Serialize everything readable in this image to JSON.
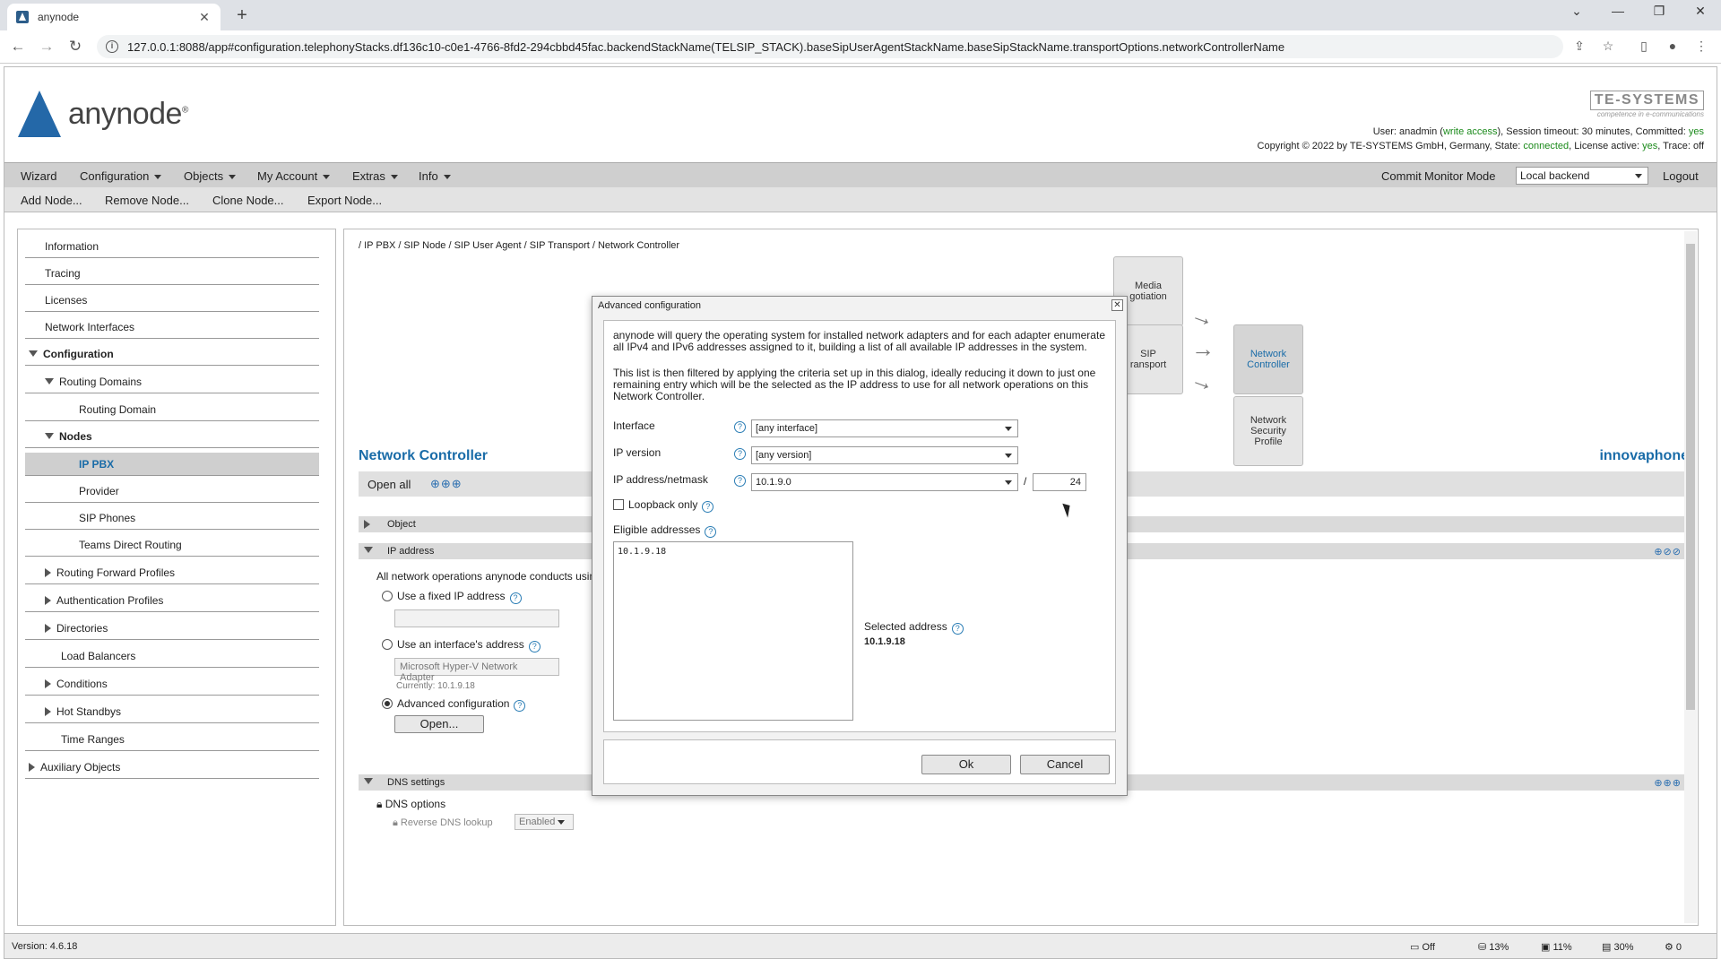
{
  "browser": {
    "tab_title": "anynode",
    "url": "127.0.0.1:8088/app#configuration.telephonyStacks.df136c10-c0e1-4766-8fd2-294cbbd45fac.backendStackName(TELSIP_STACK).baseSipUserAgentStackName.baseSipStackName.transportOptions.networkControllerName"
  },
  "header": {
    "logo_text": "anynode",
    "te_logo": "TE-SYSTEMS",
    "te_tagline": "competence in e-communications",
    "user_prefix": "User: anadmin (",
    "user_access": "write access",
    "user_suffix": "), Session timeout: 30 minutes, Committed: ",
    "committed": "yes",
    "copyright_prefix": "Copyright © 2022 by TE-SYSTEMS GmbH, Germany, State: ",
    "state": "connected",
    "license_prefix": ", License active: ",
    "license": "yes",
    "trace_prefix": ", Trace: ",
    "trace": "off"
  },
  "menu": {
    "wizard": "Wizard",
    "configuration": "Configuration",
    "objects": "Objects",
    "my_account": "My Account",
    "extras": "Extras",
    "info": "Info",
    "commit": "Commit",
    "monitor_mode": "Monitor Mode",
    "backend": "Local backend",
    "logout": "Logout"
  },
  "toolbar": {
    "add_node": "Add Node...",
    "remove_node": "Remove Node...",
    "clone_node": "Clone Node...",
    "export_node": "Export Node..."
  },
  "nav": {
    "information": "Information",
    "tracing": "Tracing",
    "licenses": "Licenses",
    "network_interfaces": "Network Interfaces",
    "configuration": "Configuration",
    "routing_domains": "Routing Domains",
    "routing_domain": "Routing Domain",
    "nodes": "Nodes",
    "ip_pbx": "IP PBX",
    "provider": "Provider",
    "sip_phones": "SIP Phones",
    "teams_direct_routing": "Teams Direct Routing",
    "routing_forward_profiles": "Routing Forward Profiles",
    "authentication_profiles": "Authentication Profiles",
    "directories": "Directories",
    "load_balancers": "Load Balancers",
    "conditions": "Conditions",
    "hot_standbys": "Hot Standbys",
    "time_ranges": "Time Ranges",
    "auxiliary_objects": "Auxiliary Objects"
  },
  "content": {
    "breadcrumb": "/ IP PBX / SIP Node / SIP User Agent / SIP Transport / Network Controller",
    "diagram": {
      "media": "Media\ngotiation",
      "transport": "SIP\nransport",
      "network_controller": "Network\nController",
      "security_profile": "Network\nSecurity\nProfile"
    },
    "title": "Network Controller",
    "brand": "innovaphone",
    "open_all": "Open all",
    "object_section": "Object",
    "ip_section": "IP address",
    "ip_description": "All network operations anynode conducts usin",
    "fixed_ip": "Use a fixed IP address",
    "interface_address": "Use an interface's address",
    "interface_value": "Microsoft Hyper-V Network Adapter",
    "currently": "Currently: 10.1.9.18",
    "advanced": "Advanced configuration",
    "open_button": "Open...",
    "dns_section": "DNS settings",
    "dns_options": "DNS options",
    "reverse_dns": "Reverse DNS lookup",
    "reverse_dns_value": "Enabled"
  },
  "status": {
    "version": "Version: 4.6.18",
    "monitor": "Off",
    "disk": "13%",
    "cpu": "11%",
    "memory": "30%",
    "alarms": "0"
  },
  "dialog": {
    "title": "Advanced configuration",
    "para1": "anynode will query the operating system for installed network adapters and for each adapter enumerate all IPv4 and IPv6 addresses assigned to it, building a list of all available IP addresses in the system.",
    "para2": "This list is then filtered by applying the criteria set up in this dialog, ideally reducing it down to just one remaining entry which will be the selected as the IP address to use for all network operations on this Network Controller.",
    "interface_label": "Interface",
    "interface_value": "[any interface]",
    "ip_version_label": "IP version",
    "ip_version_value": "[any version]",
    "ip_netmask_label": "IP address/netmask",
    "ip_value": "10.1.9.0",
    "separator": "/",
    "netmask": "24",
    "loopback": "Loopback only",
    "eligible_label": "Eligible addresses",
    "eligible": [
      "10.1.9.18"
    ],
    "selected_label": "Selected address",
    "selected_value": "10.1.9.18",
    "ok": "Ok",
    "cancel": "Cancel"
  }
}
